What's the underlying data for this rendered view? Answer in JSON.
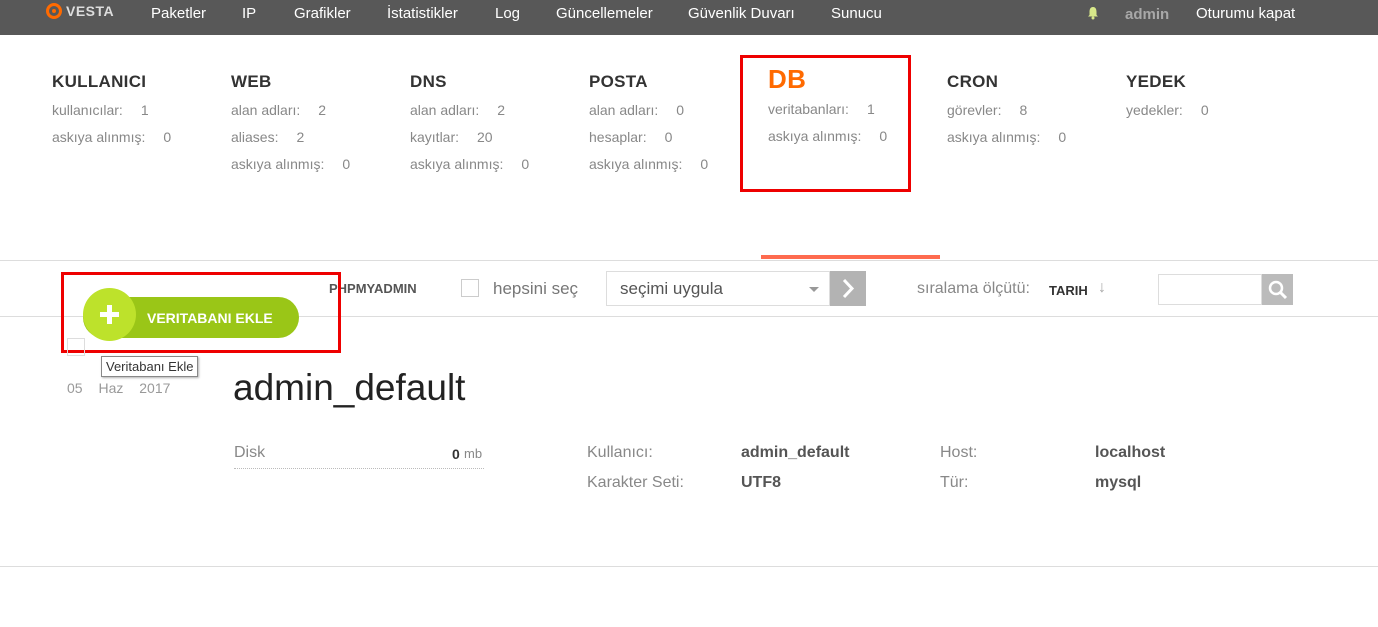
{
  "brand": {
    "name": "VESTA"
  },
  "nav": {
    "items": [
      "Paketler",
      "IP",
      "Grafikler",
      "İstatistikler",
      "Log",
      "Güncellemeler",
      "Güvenlik Duvarı",
      "Sunucu"
    ],
    "user": "admin",
    "logout": "Oturumu kapat"
  },
  "stats": [
    {
      "title": "KULLANICI",
      "rows": [
        {
          "label": "kullanıcılar:",
          "value": "1"
        },
        {
          "label": "askıya alınmış:",
          "value": "0"
        }
      ]
    },
    {
      "title": "WEB",
      "rows": [
        {
          "label": "alan adları:",
          "value": "2"
        },
        {
          "label": "aliases:",
          "value": "2"
        },
        {
          "label": "askıya alınmış:",
          "value": "0"
        }
      ]
    },
    {
      "title": "DNS",
      "rows": [
        {
          "label": "alan adları:",
          "value": "2"
        },
        {
          "label": "kayıtlar:",
          "value": "20"
        },
        {
          "label": "askıya alınmış:",
          "value": "0"
        }
      ]
    },
    {
      "title": "POSTA",
      "rows": [
        {
          "label": "alan adları:",
          "value": "0"
        },
        {
          "label": "hesaplar:",
          "value": "0"
        },
        {
          "label": "askıya alınmış:",
          "value": "0"
        }
      ]
    },
    {
      "title": "DB",
      "rows": [
        {
          "label": "veritabanları:",
          "value": "1"
        },
        {
          "label": "askıya alınmış:",
          "value": "0"
        }
      ]
    },
    {
      "title": "CRON",
      "rows": [
        {
          "label": "görevler:",
          "value": "8"
        },
        {
          "label": "askıya alınmış:",
          "value": "0"
        }
      ]
    },
    {
      "title": "YEDEK",
      "rows": [
        {
          "label": "yedekler:",
          "value": "0"
        }
      ]
    }
  ],
  "toolbar": {
    "add_label": "VERITABANI EKLE",
    "add_tooltip": "Veritabanı Ekle",
    "phpmyadmin": "PHPMYADMIN",
    "select_all": "hepsini seç",
    "bulk_action": "seçimi uygula",
    "sort_label": "sıralama ölçütü:",
    "sort_value": "TARIH",
    "sort_arrow": "↓"
  },
  "row": {
    "date": "05 Haz 2017",
    "name": "admin_default",
    "disk_label": "Disk",
    "disk_value": "0",
    "disk_unit": "mb",
    "user_label": "Kullanıcı:",
    "user_value": "admin_default",
    "charset_label": "Karakter Seti:",
    "charset_value": "UTF8",
    "host_label": "Host:",
    "host_value": "localhost",
    "type_label": "Tür:",
    "type_value": "mysql"
  },
  "colors": {
    "accent": "#ff6a00",
    "add_button": "#9ac617",
    "topbar": "#585858",
    "highlight_box": "#ee0000"
  }
}
